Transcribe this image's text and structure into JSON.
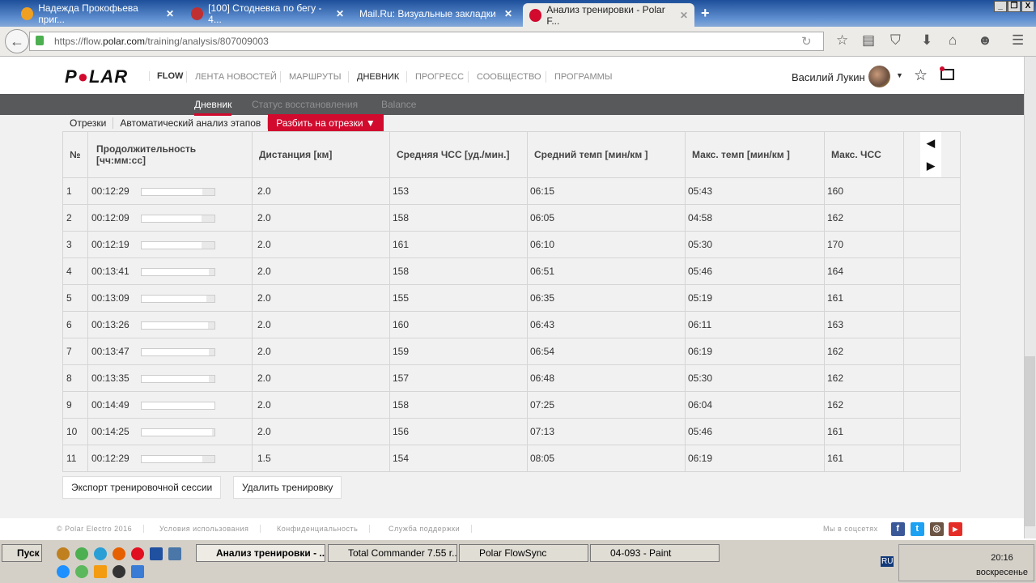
{
  "browser": {
    "tabs": [
      {
        "title": "Надежда Прокофьева приг...",
        "color": "#f0a020"
      },
      {
        "title": "[100] Стодневка по бегу - 4...",
        "color": "#c03030"
      },
      {
        "title": "Mail.Ru: Визуальные закладки",
        "color": ""
      },
      {
        "title": "Анализ тренировки - Polar F...",
        "color": "#d10a2e"
      }
    ],
    "new_tab": "+",
    "url_prefix": "https://flow.",
    "url_domain": "polar.com",
    "url_path": "/training/analysis/807009003",
    "win": [
      "_",
      "❐",
      "X"
    ]
  },
  "header": {
    "logo": "POLAR",
    "flow": "FLOW",
    "nav": [
      "ЛЕНТА НОВОСТЕЙ",
      "МАРШРУТЫ",
      "ДНЕВНИК",
      "ПРОГРЕСС",
      "СООБЩЕСТВО",
      "ПРОГРАММЫ"
    ],
    "active_nav": "ДНЕВНИК",
    "user": "Василий Лукин"
  },
  "subnav": [
    "Дневник",
    "Статус восстановления",
    "Balance"
  ],
  "segments": {
    "tabs": [
      "Отрезки",
      "Автоматический анализ этапов"
    ],
    "split_button": "Разбить на отрезки"
  },
  "table": {
    "headers": [
      "№",
      "Продолжительность [чч:мм:сс]",
      "Дистанция [км]",
      "Средняя ЧСС [уд./мин.]",
      "Средний темп [мин/км ]",
      "Макс. темп [мин/км ]",
      "Макс. ЧСС"
    ],
    "rows": [
      {
        "n": "1",
        "dur": "00:12:29",
        "fill": 0.84,
        "dist": "2.0",
        "avg_hr": "153",
        "avg_pace": "06:15",
        "max_pace": "05:43",
        "max_hr": "160"
      },
      {
        "n": "2",
        "dur": "00:12:09",
        "fill": 0.82,
        "dist": "2.0",
        "avg_hr": "158",
        "avg_pace": "06:05",
        "max_pace": "04:58",
        "max_hr": "162"
      },
      {
        "n": "3",
        "dur": "00:12:19",
        "fill": 0.83,
        "dist": "2.0",
        "avg_hr": "161",
        "avg_pace": "06:10",
        "max_pace": "05:30",
        "max_hr": "170"
      },
      {
        "n": "4",
        "dur": "00:13:41",
        "fill": 0.92,
        "dist": "2.0",
        "avg_hr": "158",
        "avg_pace": "06:51",
        "max_pace": "05:46",
        "max_hr": "164"
      },
      {
        "n": "5",
        "dur": "00:13:09",
        "fill": 0.89,
        "dist": "2.0",
        "avg_hr": "155",
        "avg_pace": "06:35",
        "max_pace": "05:19",
        "max_hr": "161"
      },
      {
        "n": "6",
        "dur": "00:13:26",
        "fill": 0.91,
        "dist": "2.0",
        "avg_hr": "160",
        "avg_pace": "06:43",
        "max_pace": "06:11",
        "max_hr": "163"
      },
      {
        "n": "7",
        "dur": "00:13:47",
        "fill": 0.93,
        "dist": "2.0",
        "avg_hr": "159",
        "avg_pace": "06:54",
        "max_pace": "06:19",
        "max_hr": "162"
      },
      {
        "n": "8",
        "dur": "00:13:35",
        "fill": 0.92,
        "dist": "2.0",
        "avg_hr": "157",
        "avg_pace": "06:48",
        "max_pace": "05:30",
        "max_hr": "162"
      },
      {
        "n": "9",
        "dur": "00:14:49",
        "fill": 1.0,
        "dist": "2.0",
        "avg_hr": "158",
        "avg_pace": "07:25",
        "max_pace": "06:04",
        "max_hr": "162"
      },
      {
        "n": "10",
        "dur": "00:14:25",
        "fill": 0.97,
        "dist": "2.0",
        "avg_hr": "156",
        "avg_pace": "07:13",
        "max_pace": "05:46",
        "max_hr": "161"
      },
      {
        "n": "11",
        "dur": "00:12:29",
        "fill": 0.84,
        "dist": "1.5",
        "avg_hr": "154",
        "avg_pace": "08:05",
        "max_pace": "06:19",
        "max_hr": "161"
      }
    ]
  },
  "actions": {
    "export": "Экспорт тренировочной сессии",
    "delete": "Удалить тренировку"
  },
  "footer": {
    "links": [
      "© Polar Electro 2016",
      "Условия использования",
      "Конфиденциальность",
      "Служба поддержки"
    ],
    "social_label": "Мы в соцсетях",
    "social": [
      "f",
      "t",
      "ig",
      "▶"
    ]
  },
  "taskbar": {
    "start": "Пуск",
    "tasks": [
      "Анализ тренировки - ...",
      "Total Commander 7.55 r...",
      "Polar FlowSync",
      "04-093 - Paint"
    ],
    "lang": "RU",
    "time": "20:16",
    "day": "воскресенье"
  }
}
